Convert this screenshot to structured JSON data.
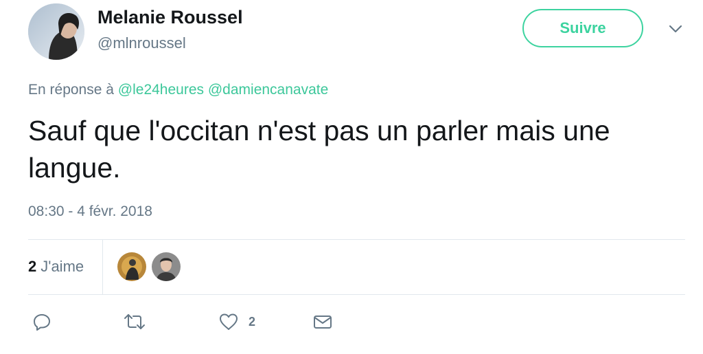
{
  "author": {
    "display_name": "Melanie Roussel",
    "handle": "@mlnroussel"
  },
  "follow_button": {
    "label": "Suivre",
    "color": "#3cd39f"
  },
  "reply_context": {
    "prefix": "En réponse à",
    "mentions": [
      "@le24heures",
      "@damiencanavate"
    ]
  },
  "tweet": {
    "text": "Sauf que l'occitan n'est pas un parler mais une langue.",
    "timestamp": "08:30 - 4 févr. 2018"
  },
  "stats": {
    "likes_count": "2",
    "likes_label": "J'aime"
  },
  "actions": {
    "reply_icon": "reply-icon",
    "retweet_icon": "retweet-icon",
    "like_icon": "heart-icon",
    "like_count": "2",
    "dm_icon": "envelope-icon"
  },
  "colors": {
    "accent": "#3cc79a",
    "secondary_text": "#657786",
    "divider": "#e1e8ed"
  }
}
